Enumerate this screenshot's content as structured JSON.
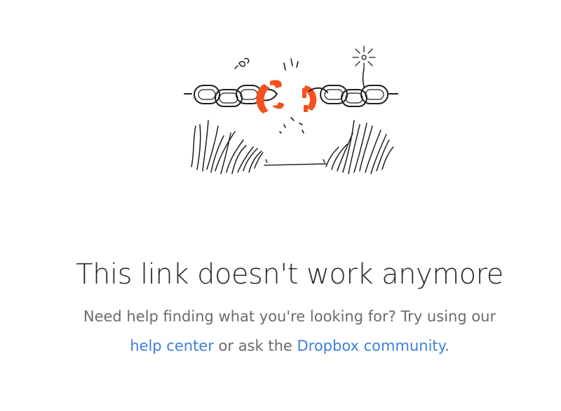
{
  "error": {
    "title": "This link doesn't work anymore",
    "line1": "Need help finding what you're looking for? Try using our",
    "help_center_link": "help center",
    "connector": " or ask the ",
    "community_link": "Dropbox community",
    "end_punct": "."
  },
  "illustration": {
    "icon": "broken-chain-illustration",
    "accent_color": "#f4511e",
    "ink_color": "#1e1e1e"
  },
  "colors": {
    "title": "#2b2b2b",
    "body_text": "#6b6b6b",
    "link": "#3f7fdc",
    "background": "#ffffff"
  }
}
